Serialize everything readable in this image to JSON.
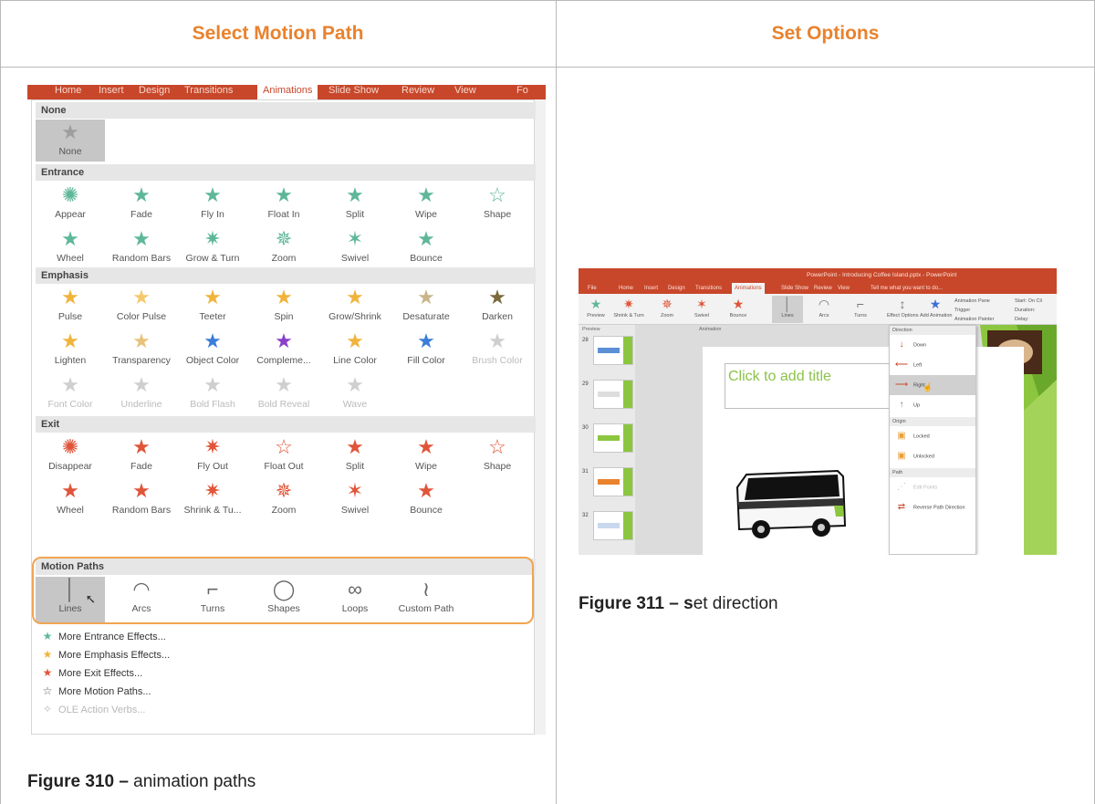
{
  "headers": {
    "left": "Select Motion Path",
    "right": "Set Options"
  },
  "captions": {
    "left": {
      "bold": "Figure 310 –",
      "text": " animation paths"
    },
    "right": {
      "bold": "Figure 311 – s",
      "text": "et direction"
    }
  },
  "colors": {
    "accent": "#e9822d",
    "ribbon": "#c8472a",
    "entrance": "#5fb79a",
    "emphasis": "#f0b43c",
    "exit": "#e0553a",
    "motion": "#e0553a",
    "highlight": "#f0a552"
  },
  "left_panel": {
    "ribbon_tabs": [
      "Home",
      "Insert",
      "Design",
      "Transitions",
      "Animations",
      "Slide Show",
      "Review",
      "View",
      "Fo"
    ],
    "active_tab": "Animations",
    "sections": {
      "none": "None",
      "entrance": "Entrance",
      "emphasis": "Emphasis",
      "exit": "Exit",
      "motion": "Motion Paths"
    },
    "none_item": "None",
    "entrance": [
      "Appear",
      "Fade",
      "Fly In",
      "Float In",
      "Split",
      "Wipe",
      "Shape",
      "Wheel",
      "Random Bars",
      "Grow & Turn",
      "Zoom",
      "Swivel",
      "Bounce"
    ],
    "emphasis": [
      "Pulse",
      "Color Pulse",
      "Teeter",
      "Spin",
      "Grow/Shrink",
      "Desaturate",
      "Darken",
      "Lighten",
      "Transparency",
      "Object Color",
      "Compleme...",
      "Line Color",
      "Fill Color",
      "Brush Color",
      "Font Color",
      "Underline",
      "Bold Flash",
      "Bold Reveal",
      "Wave"
    ],
    "exit": [
      "Disappear",
      "Fade",
      "Fly Out",
      "Float Out",
      "Split",
      "Wipe",
      "Shape",
      "Wheel",
      "Random Bars",
      "Shrink & Tu...",
      "Zoom",
      "Swivel",
      "Bounce"
    ],
    "motion": [
      "Lines",
      "Arcs",
      "Turns",
      "Shapes",
      "Loops",
      "Custom Path"
    ],
    "more": [
      "More Entrance Effects...",
      "More Emphasis Effects...",
      "More Exit Effects...",
      "More Motion Paths...",
      "OLE Action Verbs..."
    ]
  },
  "right_panel": {
    "title_bar": "PowerPoint - Introducing Coffee Island.pptx - PowerPoint",
    "tabs": [
      "File",
      "Home",
      "Insert",
      "Design",
      "Transitions",
      "Animations",
      "Slide Show",
      "Review",
      "View",
      "Tell me what you want to do..."
    ],
    "active_tab": "Animations",
    "ribbon_buttons": [
      "Preview",
      "Shrink & Turn",
      "Zoom",
      "Swivel",
      "Bounce",
      "Lines",
      "Arcs",
      "Turns",
      "Effect Options",
      "Add Animation"
    ],
    "ribbon_side": [
      "Animation Pane",
      "Trigger",
      "Animation Painter",
      "Start: On Cli",
      "Duration:",
      "Delay:"
    ],
    "pane_labels": {
      "preview": "Preview",
      "animation": "Animation"
    },
    "slide_numbers": [
      "28",
      "29",
      "30",
      "31",
      "32"
    ],
    "slide_title": "Click to add title",
    "dropdown": {
      "direction_hdr": "Direction",
      "directions": [
        "Down",
        "Left",
        "Right",
        "Up"
      ],
      "origin_hdr": "Origin",
      "origins": [
        "Locked",
        "Unlocked"
      ],
      "path_hdr": "Path",
      "paths": [
        "Edit Points",
        "Reverse Path Direction"
      ]
    }
  }
}
